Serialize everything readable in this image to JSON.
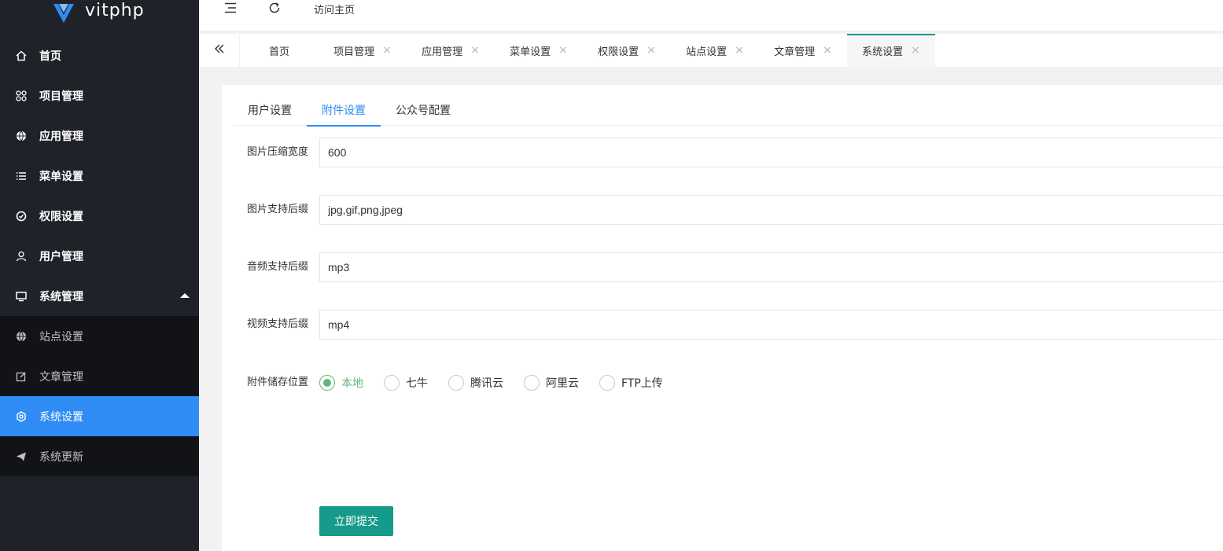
{
  "app": {
    "name": "vitphp",
    "brand_color": "#2f8cf5"
  },
  "sidebar": {
    "items": [
      {
        "label": "首页",
        "icon": "home-icon"
      },
      {
        "label": "项目管理",
        "icon": "apps-icon"
      },
      {
        "label": "应用管理",
        "icon": "globe-icon"
      },
      {
        "label": "菜单设置",
        "icon": "list-icon"
      },
      {
        "label": "权限设置",
        "icon": "shield-icon"
      },
      {
        "label": "用户管理",
        "icon": "user-icon"
      },
      {
        "label": "系统管理",
        "icon": "monitor-icon",
        "expanded": true
      }
    ],
    "sub_items": [
      {
        "label": "站点设置",
        "icon": "globe-icon"
      },
      {
        "label": "文章管理",
        "icon": "edit-icon"
      },
      {
        "label": "系统设置",
        "icon": "gear-icon",
        "active": true
      },
      {
        "label": "系统更新",
        "icon": "send-icon"
      }
    ]
  },
  "header": {
    "visit_home": "访问主页"
  },
  "tabs": [
    {
      "label": "首页",
      "closable": false
    },
    {
      "label": "项目管理",
      "closable": true
    },
    {
      "label": "应用管理",
      "closable": true
    },
    {
      "label": "菜单设置",
      "closable": true
    },
    {
      "label": "权限设置",
      "closable": true
    },
    {
      "label": "站点设置",
      "closable": true
    },
    {
      "label": "文章管理",
      "closable": true
    },
    {
      "label": "系统设置",
      "closable": true,
      "active": true
    }
  ],
  "tab_close_glyph": "×",
  "subtabs": [
    {
      "label": "用户设置"
    },
    {
      "label": "附件设置",
      "active": true
    },
    {
      "label": "公众号配置"
    }
  ],
  "form": {
    "image_width": {
      "label": "图片压缩宽度",
      "value": "600"
    },
    "image_ext": {
      "label": "图片支持后缀",
      "value": "jpg,gif,png,jpeg"
    },
    "audio_ext": {
      "label": "音频支持后缀",
      "value": "mp3"
    },
    "video_ext": {
      "label": "视频支持后缀",
      "value": "mp4"
    },
    "storage": {
      "label": "附件储存位置",
      "options": [
        "本地",
        "七牛",
        "腾讯云",
        "阿里云",
        "FTP上传"
      ],
      "selected": "本地"
    },
    "submit_label": "立即提交"
  },
  "colors": {
    "accent": "#169a89",
    "radio_checked": "#5fb878",
    "sidebar_bg": "#20222a",
    "active_nav": "#2f8cf5"
  }
}
